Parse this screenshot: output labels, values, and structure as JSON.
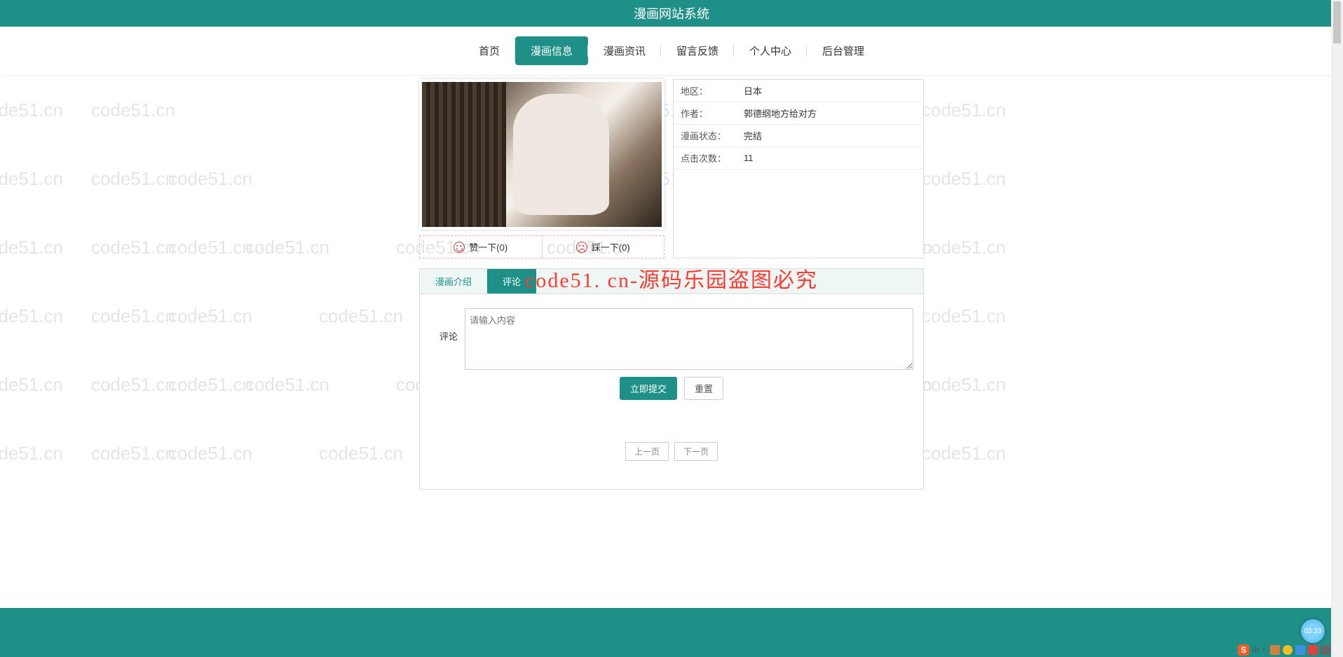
{
  "header": {
    "title": "漫画网站系统"
  },
  "nav": {
    "items": [
      {
        "label": "首页",
        "active": false
      },
      {
        "label": "漫画信息",
        "active": true
      },
      {
        "label": "漫画资讯",
        "active": false
      },
      {
        "label": "留言反馈",
        "active": false
      },
      {
        "label": "个人中心",
        "active": false
      },
      {
        "label": "后台管理",
        "active": false
      }
    ]
  },
  "vote": {
    "up_label": "赞一下(0)",
    "down_label": "踩一下(0)"
  },
  "info": {
    "rows": [
      {
        "k": "地区：",
        "v": "日本"
      },
      {
        "k": "作者：",
        "v": "郭德纲地方给对方"
      },
      {
        "k": "漫画状态：",
        "v": "完结"
      },
      {
        "k": "点击次数：",
        "v": "11"
      }
    ]
  },
  "tabs": {
    "intro": "漫画介绍",
    "comment": "评论"
  },
  "form": {
    "label": "评论",
    "placeholder": "请输入内容",
    "submit": "立即提交",
    "reset": "重置"
  },
  "pager": {
    "prev": "上一页",
    "next": "下一页"
  },
  "overlay": {
    "text": "code51. cn-源码乐园盗图必究"
  },
  "watermark": {
    "text": "code51.cn"
  },
  "tray": {
    "ime": "中",
    "clock": "03:33"
  }
}
